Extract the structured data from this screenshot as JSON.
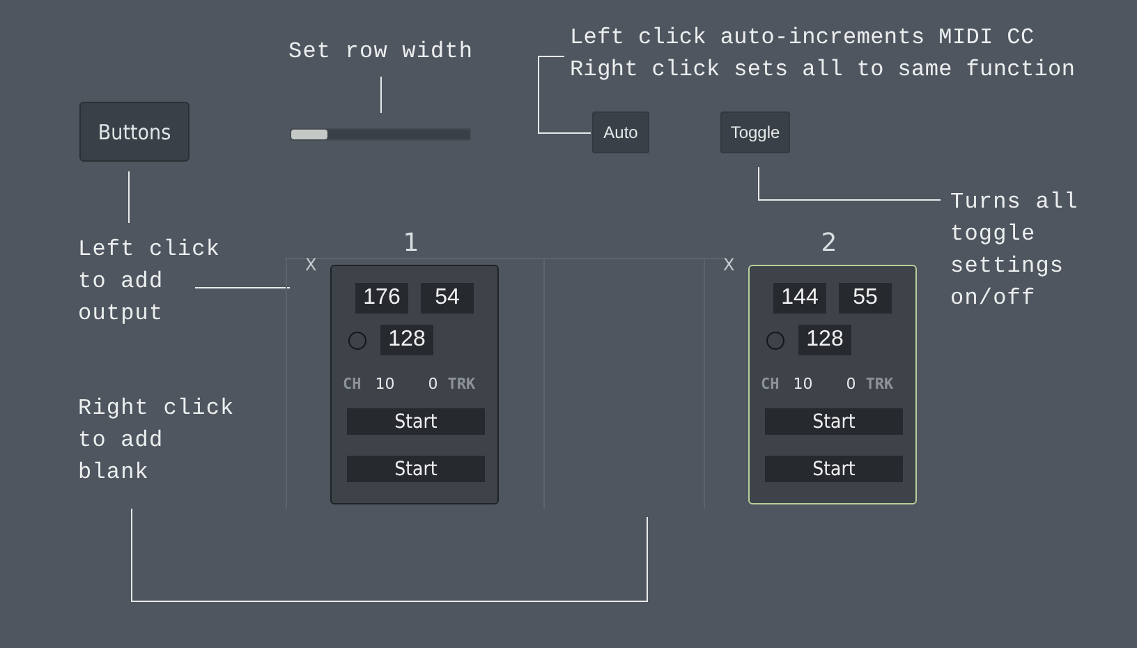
{
  "annotations": [
    {
      "kind": "top",
      "text": "Set row width"
    },
    {
      "kind": "midi",
      "text": "Left click auto-increments MIDI CC\nRight click sets all to same function"
    },
    {
      "kind": "toggle",
      "text": "Turns all\ntoggle\nsettings\non/off"
    },
    {
      "kind": "output",
      "text": "Left click\nto add\noutput"
    },
    {
      "kind": "blank",
      "text": "Right click\nto add\nblank"
    }
  ],
  "buttons_button": "Buttons",
  "row_width_slider": {
    "level": 0.2
  },
  "auto_button": "Auto",
  "toggle_button": "Toggle",
  "units": [
    {
      "number": "1",
      "remove": "X",
      "selected": false,
      "cc": "176",
      "value": "54",
      "velocity": "128",
      "ch_label": "CH",
      "channel": "10",
      "track": "0",
      "trk_label": "TRK",
      "actions": [
        "Start",
        "Start"
      ]
    },
    {
      "number": "2",
      "remove": "X",
      "selected": true,
      "cc": "144",
      "value": "55",
      "velocity": "128",
      "ch_label": "CH",
      "channel": "10",
      "track": "0",
      "trk_label": "TRK",
      "actions": [
        "Start",
        "Start"
      ]
    }
  ]
}
